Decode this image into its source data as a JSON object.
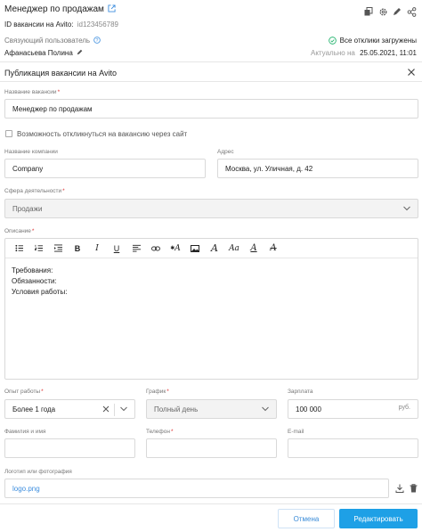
{
  "header": {
    "title": "Менеджер по продажам",
    "avito_id_label": "ID вакансии на Avito:",
    "avito_id_value": "id123456789",
    "linked_user_label": "Связующий пользователь",
    "linked_user_name": "Афанасьева Полина",
    "all_loaded_text": "Все отклики загружены",
    "actual_label": "Актуально на",
    "actual_value": "25.05.2021, 11:01",
    "icons": [
      "external-link-icon",
      "copy-icon",
      "gear-icon",
      "pencil-icon",
      "share-icon"
    ]
  },
  "form": {
    "section_title": "Публикация вакансии на Avito",
    "vacancy_name_label": "Название вакансии",
    "vacancy_name_value": "Менеджер по продажам",
    "checkbox_label": "Возможность откликнуться на вакансию через сайт",
    "company_label": "Название компании",
    "company_value": "Company",
    "address_label": "Адрес",
    "address_value": "Москва, ул. Уличная, д. 42",
    "sphere_label": "Сфера деятельности",
    "sphere_value": "Продажи",
    "description_label": "Описание",
    "description_lines": [
      "Требования:",
      "Обязанности:",
      "Условия работы:"
    ],
    "experience_label": "Опыт работы",
    "experience_value": "Более 1 года",
    "schedule_label": "График",
    "schedule_value": "Полный день",
    "salary_label": "Зарплата",
    "salary_value": "100 000",
    "salary_suffix": "руб.",
    "fullname_label": "Фамилия и имя",
    "phone_label": "Телефон",
    "email_label": "E-mail",
    "logo_label": "Логотип или фотография",
    "logo_value": "logo.png",
    "required_mark": "*"
  },
  "toolbar": {
    "bold": "B",
    "italic": "I",
    "underline": "U",
    "font_a1": "A",
    "font_a2": "A",
    "font_aa": "Aa",
    "font_a3": "A",
    "font_a4": "A"
  },
  "buttons": {
    "cancel": "Отмена",
    "edit": "Редактировать"
  },
  "colors": {
    "primary": "#1ea0e6",
    "link": "#3c8dde",
    "success": "#2bb673",
    "required": "#d33333"
  }
}
